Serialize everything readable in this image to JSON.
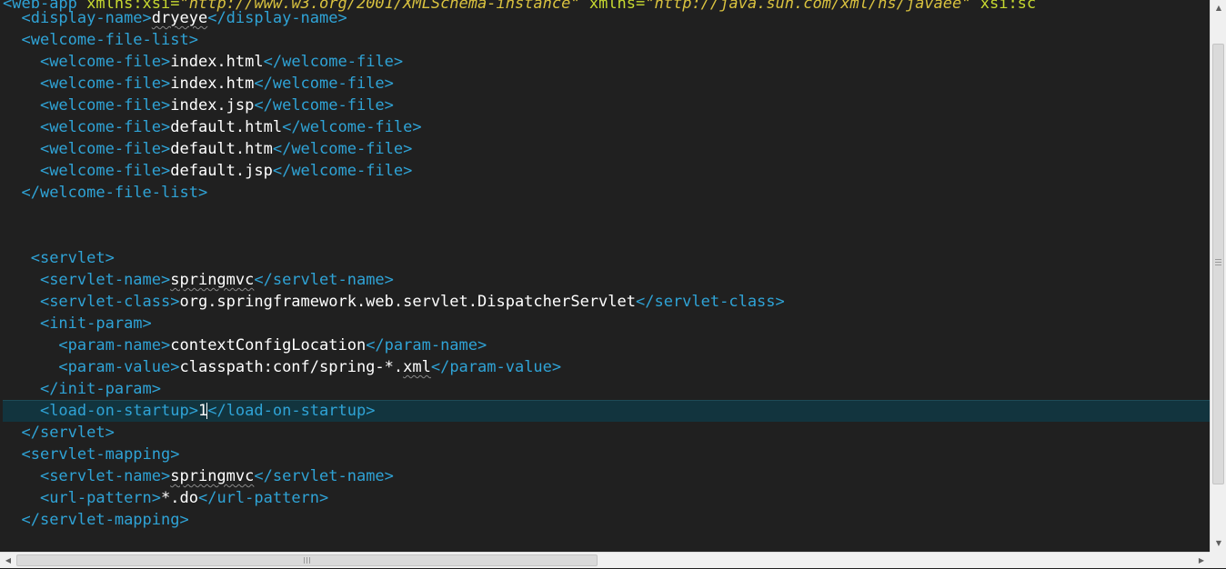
{
  "editor": {
    "line0": {
      "open_bracket": "<",
      "tag": "web-app",
      "attr1": " xmlns:xsi=",
      "val1": "\"http://www.w3.org/2001/XMLSchema-instance\"",
      "attr2": " xmlns=",
      "val2": "\"http://java.sun.com/xml/ns/javaee\"",
      "attr3": " xsi:sc"
    },
    "display_name": {
      "open": "<display-name>",
      "text": "dryeye",
      "close": "</display-name>"
    },
    "welcome_file_list_open": "<welcome-file-list>",
    "welcome_files": [
      {
        "open": "<welcome-file>",
        "text": "index.html",
        "close": "</welcome-file>"
      },
      {
        "open": "<welcome-file>",
        "text": "index.htm",
        "close": "</welcome-file>"
      },
      {
        "open": "<welcome-file>",
        "text": "index.jsp",
        "close": "</welcome-file>"
      },
      {
        "open": "<welcome-file>",
        "text": "default.html",
        "close": "</welcome-file>"
      },
      {
        "open": "<welcome-file>",
        "text": "default.htm",
        "close": "</welcome-file>"
      },
      {
        "open": "<welcome-file>",
        "text": "default.jsp",
        "close": "</welcome-file>"
      }
    ],
    "welcome_file_list_close": "</welcome-file-list>",
    "servlet_open": "<servlet>",
    "servlet_name": {
      "open": "<servlet-name>",
      "text": "springmvc",
      "close": "</servlet-name>"
    },
    "servlet_class": {
      "open": "<servlet-class>",
      "text": "org.springframework.web.servlet.DispatcherServlet",
      "close": "</servlet-class>"
    },
    "init_param_open": "<init-param>",
    "param_name": {
      "open": "<param-name>",
      "text": "contextConfigLocation",
      "close": "</param-name>"
    },
    "param_value": {
      "open": "<param-value>",
      "text_pre": "classpath:conf/spring-*.",
      "text_ext": "xml",
      "close": "</param-value>"
    },
    "init_param_close": "</init-param>",
    "load_on_startup": {
      "open": "<load-on-startup>",
      "text": "1",
      "close_bracket": "<",
      "close_rest": "/load-on-startup>"
    },
    "servlet_close": "</servlet>",
    "servlet_mapping_open": "<servlet-mapping>",
    "mapping_servlet_name": {
      "open": "<servlet-name>",
      "text": "springmvc",
      "close": "</servlet-name>"
    },
    "url_pattern": {
      "open": "<url-pattern>",
      "text": "*.do",
      "close": "</url-pattern>"
    },
    "servlet_mapping_close": "</servlet-mapping>"
  },
  "colors": {
    "background": "#202020",
    "tag": "#2fa3d6",
    "text": "#ffffff",
    "attribute": "#c7d930",
    "attribute_value": "#d9c23f",
    "current_line": "#12343e",
    "scrollbar": "#f0f0f0"
  },
  "scrollbars": {
    "up_icon": "scroll-up-arrow-icon",
    "down_icon": "scroll-down-arrow-icon",
    "left_icon": "scroll-left-arrow-icon",
    "right_icon": "scroll-right-arrow-icon",
    "up_glyph": "▲",
    "down_glyph": "▼",
    "left_glyph": "◀",
    "right_glyph": "▶"
  }
}
